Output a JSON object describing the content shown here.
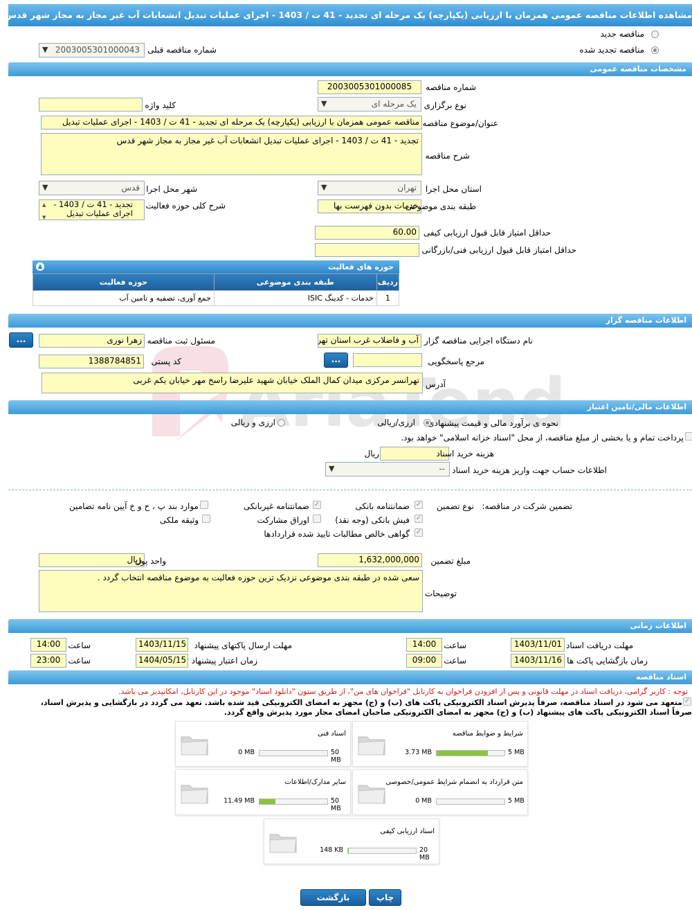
{
  "page_title": "مشاهده اطلاعات مناقصه عمومی همزمان با ارزیابی (یکپارچه) یک مرحله ای تجدید - 41 ت / 1403 - اجرای عملیات تبدیل انشعابات آب غیر مجاز به مجاز شهر قدس",
  "tender_mode": {
    "new_label": "مناقصه جدید",
    "renewed_label": "مناقصه تجدید شده",
    "prev_label": "شماره مناقصه قبلی",
    "prev_value": "2003005301000043"
  },
  "general": {
    "section_title": "مشخصات مناقصه عمومی",
    "number_label": "شماره مناقصه",
    "number_value": "2003005301000085",
    "type_label": "نوع برگزاری",
    "type_value": "یک مرحله ای",
    "keyword_label": "کلید واژه",
    "keyword_value": "",
    "subject_label": "عنوان/موضوع مناقصه",
    "subject_value": "مناقصه عمومی همزمان با ارزیابی (یکپارچه) یک مرحله ای تجدید - 41 ت / 1403 - اجرای عملیات تبدیل",
    "desc_label": "شرح مناقصه",
    "desc_value": "تجدید - 41 ت / 1403 - اجرای عملیات تبدیل انشعابات آب غیر مجاز به مجاز شهر قدس",
    "province_label": "استان محل اجرا",
    "province_value": "تهران",
    "city_label": "شهر محل اجرا",
    "city_value": "قدس",
    "category_label": "طبقه بندی موضوعی",
    "category_value": "خدمات بدون فهرست بها",
    "scope_label": "شرح کلی حوزه فعالیت",
    "scope_value": "تجدید - 41 ت / 1403 - اجرای عملیات تبدیل",
    "min_quality_label": "حداقل امتیاز قابل قبول ارزیابی کیفی",
    "min_quality_value": "60.00",
    "min_tech_label": "حداقل امتیاز قابل قبول ارزیابی فنی/بازرگانی",
    "min_tech_value": ""
  },
  "activities": {
    "title": "حوزه های فعالیت",
    "headers": [
      "ردیف",
      "طبقه بندی موضوعی",
      "حوزه فعالیت"
    ],
    "rows": [
      [
        "1",
        "خدمات - کدینگ ISIC",
        "جمع آوری، تصفیه و تامین آب"
      ]
    ]
  },
  "organizer": {
    "section_title": "اطلاعات مناقصه گزار",
    "agency_label": "نام دستگاه اجرایی مناقصه گزار",
    "agency_value": "آب و فاضلاب غرب استان تهران",
    "registrar_label": "مسئول ثبت مناقصه",
    "registrar_value": "زهرا نوری",
    "ref_label": "مرجع پاسخگویی",
    "ref_value": "",
    "postal_label": "کد پستی",
    "postal_value": "1388784851",
    "address_label": "آدرس",
    "address_value": "تهرانسر مرکزی میدان کمال الملک خیابان شهید علیرضا راسخ مهر خیابان یکم غربی",
    "more_button": "..."
  },
  "finance": {
    "section_title": "اطلاعات مالی/تامین اعتبار",
    "estimate_label": "نحوه ی برآورد مالی و قیمت پیشنهادی",
    "opt1": "ارزی/ریالی",
    "opt2": "ارزی و ریالی",
    "treasury_text": "پرداخت تمام و یا بخشی از مبلغ مناقصه، از محل \"اسناد خزانه اسلامی\" خواهد بود.",
    "doc_cost_label": "هزینه خرید اسناد",
    "doc_cost_value": "",
    "doc_cost_unit": "ریال",
    "account_label": "اطلاعات حساب جهت واریز هزینه خرید اسناد",
    "account_value": "--"
  },
  "guarantee": {
    "participation_label": "تضمین شرکت در مناقصه:",
    "type_label": "نوع تضمین",
    "options": [
      "ضمانتنامه بانکی",
      "ضمانتنامه غیربانکی",
      "موارد بند پ ، ح و خ آیین نامه تضامین",
      "فیش بانکی (وجه نقد)",
      "اوراق مشارکت",
      "وثیقه ملکی",
      "گواهی خالص مطالبات تایید شده قراردادها"
    ],
    "amount_label": "مبلغ تضمین",
    "amount_value": "1,632,000,000",
    "currency_label": "واحد پول",
    "currency_value": "ریال",
    "notes_label": "توضیحات",
    "notes_value": "سعی شده در طبقه بندی موضوعی نزدیک ترین حوزه فعالیت به موضوع مناقصه انتخاب گردد ."
  },
  "timing": {
    "section_title": "اطلاعات زمانی",
    "receive_label": "مهلت دریافت اسناد",
    "receive_date": "1403/11/01",
    "receive_time": "14:00",
    "send_label": "مهلت ارسال پاکتهای پیشنهاد",
    "send_date": "1403/11/15",
    "send_time": "14:00",
    "open_label": "زمان بازگشایی پاکت ها",
    "open_date": "1403/11/16",
    "open_time": "09:00",
    "validity_label": "زمان اعتبار پیشنهاد",
    "validity_date": "1404/05/15",
    "validity_time": "23:00",
    "time_label": "ساعت"
  },
  "documents": {
    "section_title": "اسناد مناقصه",
    "note": "توجه : کاربر گرامی، دریافت اسناد در مهلت قانونی و پس از افزودن فراخوان به کارتابل \"فراخوان های من\"، از طریق ستون \"دانلود اسناد\" موجود در این کارتابل، امکانپذیر می باشد.",
    "commit1": "متعهد می شود در اسناد مناقصه، صرفاً پذیرش اسناد الکترونیکی پاکت های (ب) و (ج) مجهز به امضای الکترونیکی قید شده باشد. تعهد می گردد در بازگشایی و پذیرش اسناد،",
    "commit2": "صرفاً اسناد الکترونیکی پاکت های پیشنهاد (ب) و (ج) مجهز به امضای الکترونیکی صاحبان امضای مجاز مورد پذیرش واقع گردد.",
    "items": [
      {
        "title": "شرایط و ضوابط مناقصه",
        "used": "3.73 MB",
        "total": "5 MB",
        "percent": 75
      },
      {
        "title": "اسناد فنی",
        "used": "0 MB",
        "total": "50 MB",
        "percent": 0
      },
      {
        "title": "متن قرارداد به انضمام شرایط عمومی/خصوصی",
        "used": "0 MB",
        "total": "5 MB",
        "percent": 0
      },
      {
        "title": "سایر مدارک/اطلاعات",
        "used": "11.49 MB",
        "total": "50 MB",
        "percent": 23
      },
      {
        "title": "اسناد ارزیابی کیفی",
        "used": "148 KB",
        "total": "20 MB",
        "percent": 1
      }
    ]
  },
  "footer": {
    "print": "چاپ",
    "back": "بازگشت"
  },
  "watermark": "AriaTender.neT"
}
